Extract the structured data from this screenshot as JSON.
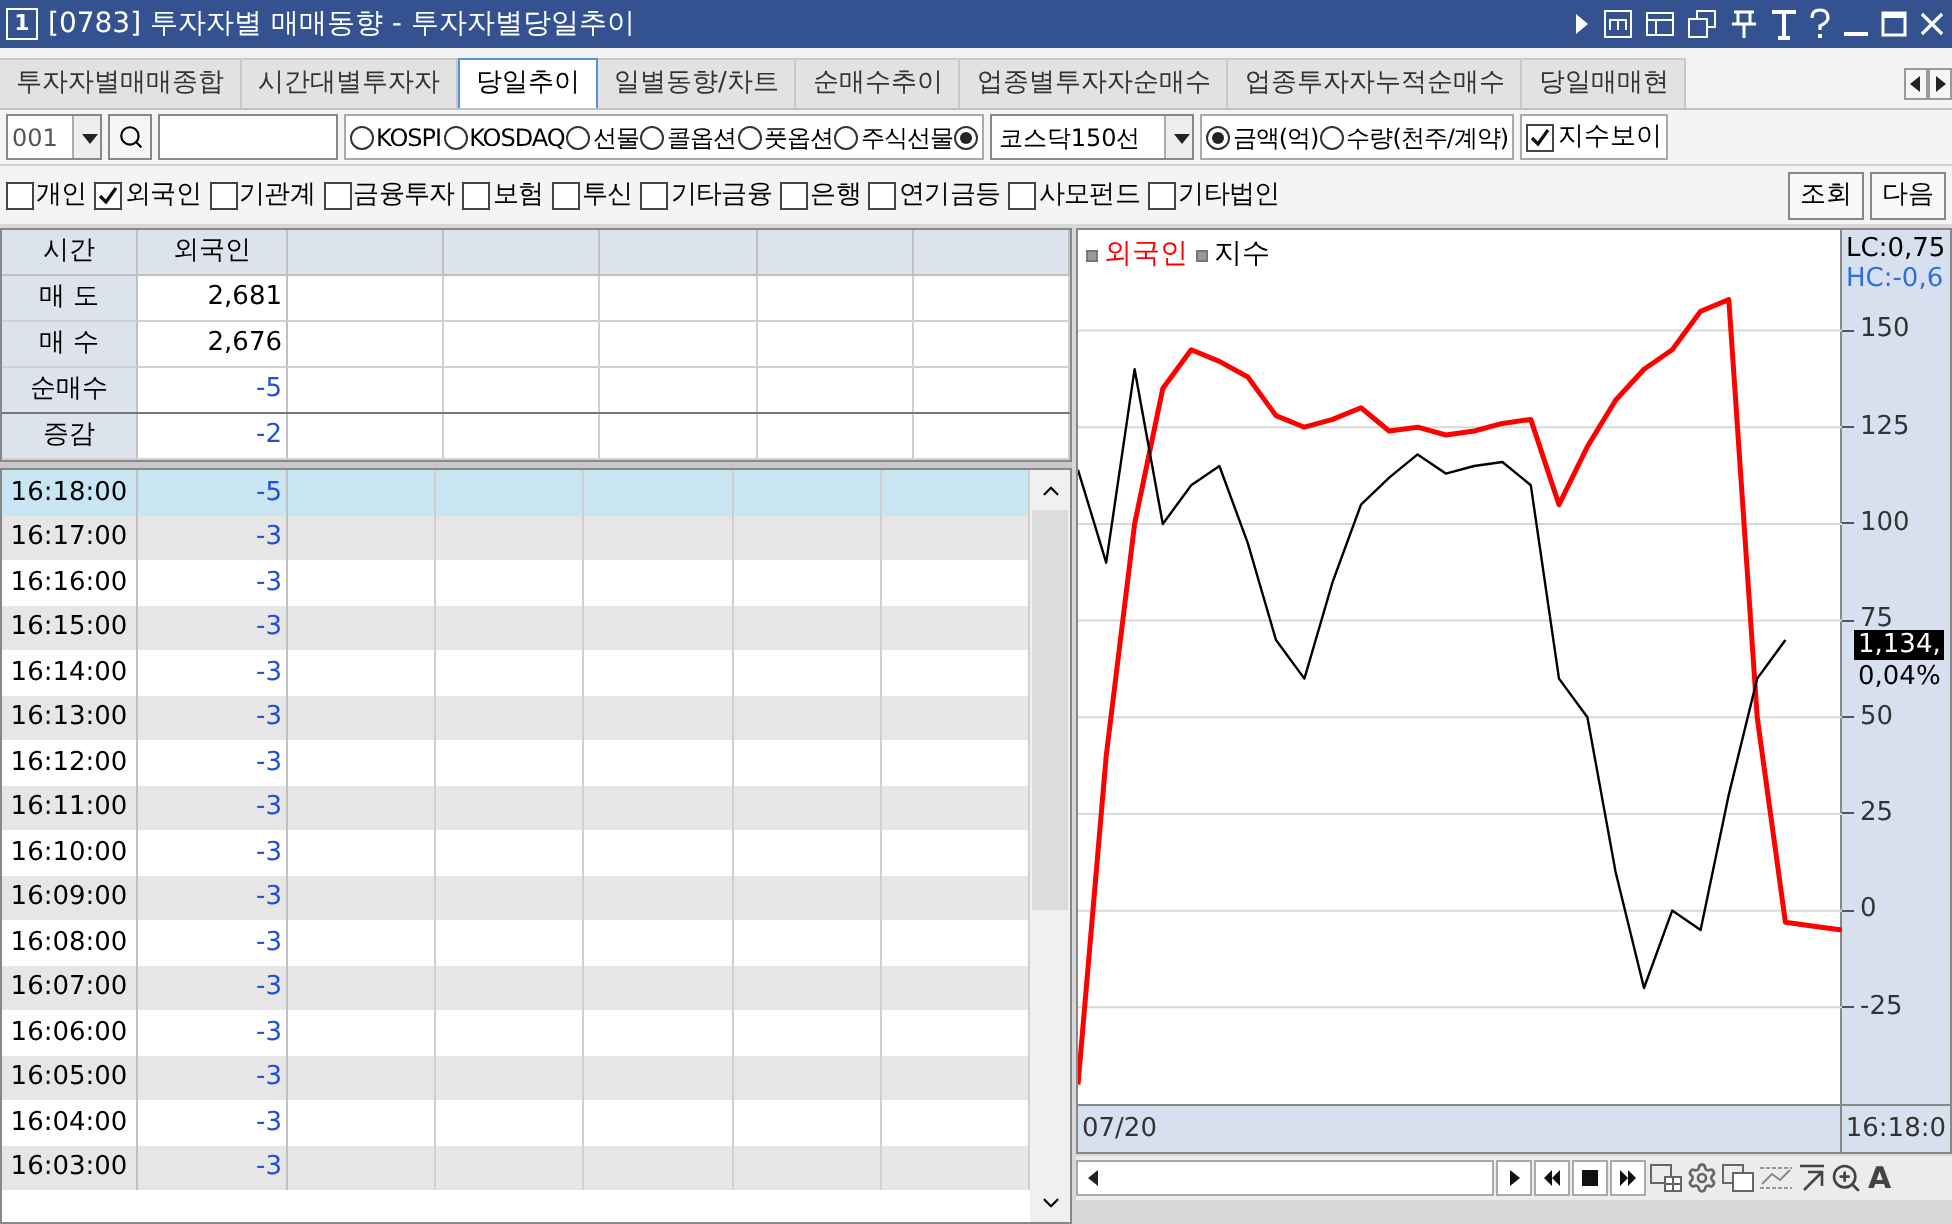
{
  "window": {
    "badge": "1",
    "title": "[0783] 투자자별 매매동향 - 투자자별당일추이"
  },
  "tabs": [
    {
      "label": "투자자별매매종합",
      "selected": false
    },
    {
      "label": "시간대별투자자",
      "selected": false
    },
    {
      "label": "당일추이",
      "selected": true
    },
    {
      "label": "일별동향/차트",
      "selected": false
    },
    {
      "label": "순매수추이",
      "selected": false
    },
    {
      "label": "업종별투자자순매수",
      "selected": false
    },
    {
      "label": "업종투자자누적순매수",
      "selected": false
    },
    {
      "label": "당일매매현",
      "selected": false
    }
  ],
  "toolbar": {
    "code": "001",
    "markets": [
      {
        "label": "KOSPI",
        "selected": false
      },
      {
        "label": "KOSDAQ",
        "selected": false
      },
      {
        "label": "선물",
        "selected": false
      },
      {
        "label": "콜옵션",
        "selected": false
      },
      {
        "label": "풋옵션",
        "selected": false
      },
      {
        "label": "주식선물",
        "selected": false
      },
      {
        "selected": true
      }
    ],
    "market_select": "코스닥150선",
    "units": [
      {
        "label": "금액(억)",
        "selected": true
      },
      {
        "label": "수량(천주/계약)",
        "selected": false
      }
    ],
    "show_index": {
      "label": "지수보이",
      "checked": true
    }
  },
  "investors": [
    {
      "label": "개인",
      "checked": false
    },
    {
      "label": "외국인",
      "checked": true
    },
    {
      "label": "기관계",
      "checked": false
    },
    {
      "label": "금융투자",
      "checked": false
    },
    {
      "label": "보험",
      "checked": false
    },
    {
      "label": "투신",
      "checked": false
    },
    {
      "label": "기타금융",
      "checked": false
    },
    {
      "label": "은행",
      "checked": false
    },
    {
      "label": "연기금등",
      "checked": false
    },
    {
      "label": "사모펀드",
      "checked": false
    },
    {
      "label": "기타법인",
      "checked": false
    }
  ],
  "buttons": [
    "조회",
    "다음"
  ],
  "summary": {
    "columns": [
      "시간",
      "외국인"
    ],
    "rows": [
      {
        "label": "매 도",
        "value": "2,681",
        "color": "#000000"
      },
      {
        "label": "매 수",
        "value": "2,676",
        "color": "#000000"
      },
      {
        "label": "순매수",
        "value": "-5",
        "color": "#1f4fd8"
      },
      {
        "label": "증감",
        "value": "-2",
        "color": "#1f4fd8"
      }
    ]
  },
  "timeline": [
    {
      "time": "16:18:00",
      "value": "-5",
      "color": "#1f4fd8",
      "selected": true
    },
    {
      "time": "16:17:00",
      "value": "-3",
      "color": "#1f4fd8",
      "selected": false
    },
    {
      "time": "16:16:00",
      "value": "-3",
      "color": "#1f4fd8",
      "selected": false
    },
    {
      "time": "16:15:00",
      "value": "-3",
      "color": "#1f4fd8",
      "selected": false
    },
    {
      "time": "16:14:00",
      "value": "-3",
      "color": "#1f4fd8",
      "selected": false
    },
    {
      "time": "16:13:00",
      "value": "-3",
      "color": "#1f4fd8",
      "selected": false
    },
    {
      "time": "16:12:00",
      "value": "-3",
      "color": "#1f4fd8",
      "selected": false
    },
    {
      "time": "16:11:00",
      "value": "-3",
      "color": "#1f4fd8",
      "selected": false
    },
    {
      "time": "16:10:00",
      "value": "-3",
      "color": "#1f4fd8",
      "selected": false
    },
    {
      "time": "16:09:00",
      "value": "-3",
      "color": "#1f4fd8",
      "selected": false
    },
    {
      "time": "16:08:00",
      "value": "-3",
      "color": "#1f4fd8",
      "selected": false
    },
    {
      "time": "16:07:00",
      "value": "-3",
      "color": "#1f4fd8",
      "selected": false
    },
    {
      "time": "16:06:00",
      "value": "-3",
      "color": "#1f4fd8",
      "selected": false
    },
    {
      "time": "16:05:00",
      "value": "-3",
      "color": "#1f4fd8",
      "selected": false
    },
    {
      "time": "16:04:00",
      "value": "-3",
      "color": "#1f4fd8",
      "selected": false
    },
    {
      "time": "16:03:00",
      "value": "-3",
      "color": "#1f4fd8",
      "selected": false
    }
  ],
  "chart": {
    "lc": "LC:0,75",
    "hc": "HC:-0,6",
    "price": "1,134,",
    "change": "0,04%",
    "start_date": "07/20",
    "end_time": "16:18:0",
    "chart_data": {
      "type": "line",
      "ylim": [
        -50,
        176
      ],
      "grid": true,
      "yticks": [
        150,
        125,
        100,
        75,
        50,
        25,
        0,
        -25
      ],
      "series": [
        {
          "name": "외국인",
          "color": "#ff0000",
          "values": [
            -45,
            40,
            100,
            135,
            145,
            142,
            138,
            128,
            125,
            127,
            130,
            124,
            125,
            123,
            124,
            126,
            127,
            105,
            120,
            132,
            140,
            145,
            155,
            158,
            50,
            -3,
            -4,
            -5
          ]
        },
        {
          "name": "지수",
          "color": "#000000",
          "values": [
            114,
            90,
            140,
            100,
            110,
            115,
            95,
            70,
            60,
            85,
            105,
            112,
            118,
            113,
            115,
            116,
            110,
            60,
            50,
            10,
            -20,
            0,
            -5,
            30,
            60,
            70,
            null,
            null
          ]
        }
      ]
    }
  },
  "font_button": "A"
}
